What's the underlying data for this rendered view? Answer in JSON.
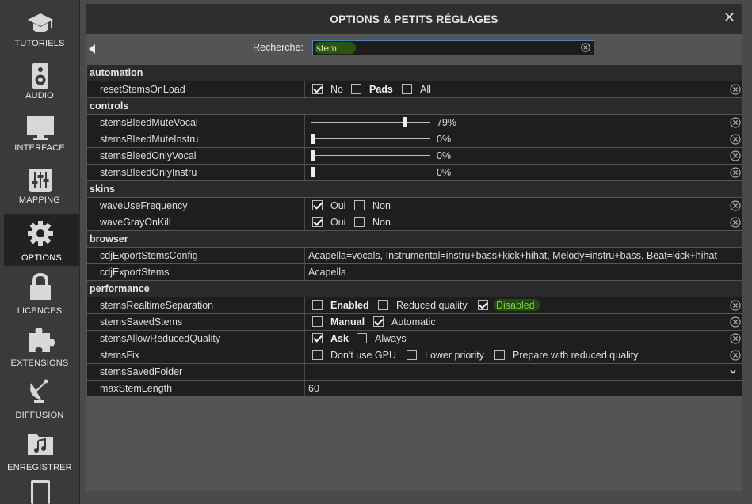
{
  "sidebar": {
    "items": [
      {
        "label": "TUTORIELS",
        "icon": "graduation-cap-icon"
      },
      {
        "label": "AUDIO",
        "icon": "speaker-icon"
      },
      {
        "label": "INTERFACE",
        "icon": "monitor-icon"
      },
      {
        "label": "MAPPING",
        "icon": "sliders-icon"
      },
      {
        "label": "OPTIONS",
        "icon": "gear-icon",
        "active": true
      },
      {
        "label": "LICENCES",
        "icon": "lock-icon"
      },
      {
        "label": "EXTENSIONS",
        "icon": "puzzle-icon"
      },
      {
        "label": "DIFFUSION",
        "icon": "satellite-dish-icon"
      },
      {
        "label": "ENREGISTRER",
        "icon": "music-folder-icon"
      }
    ]
  },
  "dialog": {
    "title": "OPTIONS & PETITS RÉGLAGES",
    "search_label": "Recherche:",
    "search_value": "stem"
  },
  "colors": {
    "accent_green": "#7fd14a",
    "row_bg": "#1e1e1e",
    "group_bg": "#2a2a2a"
  },
  "groups": {
    "automation": "automation",
    "controls": "controls",
    "skins": "skins",
    "browser": "browser",
    "performance": "performance"
  },
  "rows": {
    "resetStemsOnLoad": {
      "name": "resetStemsOnLoad",
      "opts": [
        "No",
        "Pads",
        "All"
      ]
    },
    "stemsBleedMuteVocal": {
      "name": "stemsBleedMuteVocal",
      "value_text": "79%",
      "value": 0.79
    },
    "stemsBleedMuteInstru": {
      "name": "stemsBleedMuteInstru",
      "value_text": "0%",
      "value": 0
    },
    "stemsBleedOnlyVocal": {
      "name": "stemsBleedOnlyVocal",
      "value_text": "0%",
      "value": 0
    },
    "stemsBleedOnlyInstru": {
      "name": "stemsBleedOnlyInstru",
      "value_text": "0%",
      "value": 0
    },
    "waveUseFrequency": {
      "name": "waveUseFrequency",
      "opts": [
        "Oui",
        "Non"
      ]
    },
    "waveGrayOnKill": {
      "name": "waveGrayOnKill",
      "opts": [
        "Oui",
        "Non"
      ]
    },
    "cdjExportStemsConfig": {
      "name": "cdjExportStemsConfig",
      "value": "Acapella=vocals, Instrumental=instru+bass+kick+hihat, Melody=instru+bass, Beat=kick+hihat"
    },
    "cdjExportStems": {
      "name": "cdjExportStems",
      "value": "Acapella"
    },
    "stemsRealtimeSeparation": {
      "name": "stemsRealtimeSeparation",
      "opts": [
        "Enabled",
        "Reduced quality",
        "Disabled"
      ]
    },
    "stemsSavedStems": {
      "name": "stemsSavedStems",
      "opts": [
        "Manual",
        "Automatic"
      ]
    },
    "stemsAllowReducedQuality": {
      "name": "stemsAllowReducedQuality",
      "opts": [
        "Ask",
        "Always"
      ]
    },
    "stemsFix": {
      "name": "stemsFix",
      "opts": [
        "Don't use GPU",
        "Lower priority",
        "Prepare with reduced quality"
      ]
    },
    "stemsSavedFolder": {
      "name": "stemsSavedFolder",
      "value": ""
    },
    "maxStemLength": {
      "name": "maxStemLength",
      "value": "60"
    }
  }
}
